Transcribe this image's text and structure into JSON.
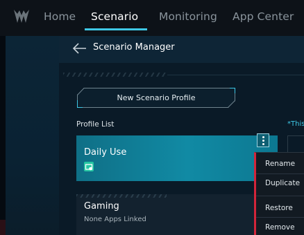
{
  "nav": {
    "items": [
      {
        "label": "Home"
      },
      {
        "label": "Scenario",
        "active": true
      },
      {
        "label": "Monitoring"
      },
      {
        "label": "App Center"
      }
    ],
    "logo_icon": "predator-logo-icon"
  },
  "header": {
    "back_icon": "arrow-left-icon",
    "title": "Scenario Manager"
  },
  "main": {
    "new_profile_button": "New Scenario Profile",
    "profile_list_label": "Profile List",
    "note_text": "*This",
    "profiles": [
      {
        "name": "Daily Use",
        "selected": true,
        "app_icon": "linked-app-icon"
      },
      {
        "name": "Gaming",
        "subtitle": "None Apps Linked"
      }
    ],
    "more_icon": "kebab-menu-icon"
  },
  "context_menu": {
    "items": [
      {
        "label": "Rename"
      },
      {
        "label": "Duplicate"
      },
      {
        "label": "Restore"
      },
      {
        "label": "Remove"
      }
    ]
  },
  "colors": {
    "accent": "#3ec8e6",
    "card_selected": "#118aa4",
    "menu_accent": "#d3253a",
    "background": "#07111b"
  }
}
